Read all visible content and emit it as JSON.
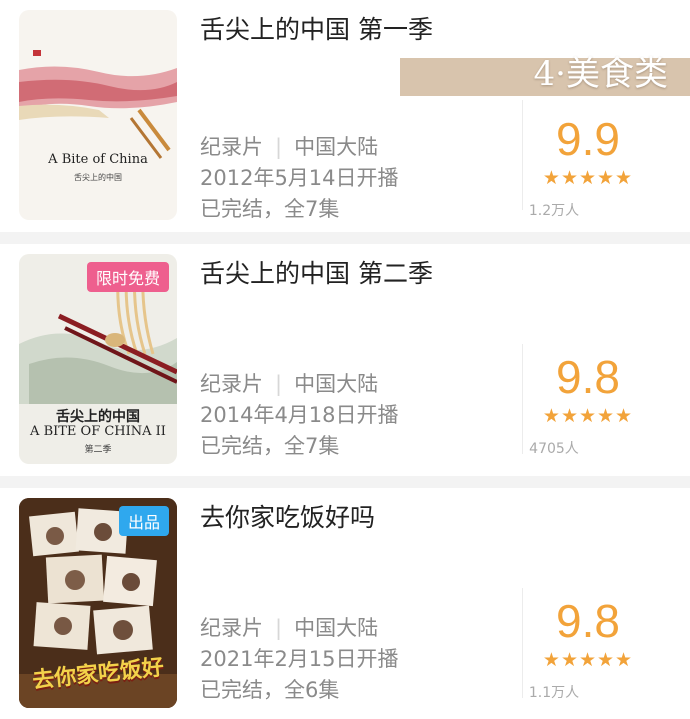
{
  "banner": {
    "text": "4·美食类"
  },
  "stars": "★★★★★",
  "items": [
    {
      "title": "舌尖上的中国 第一季",
      "genre": "纪录片",
      "region": "中国大陆",
      "premiere": "2012年5月14日开播",
      "status": "已完结，全7集",
      "score": "9.9",
      "votes": "1.2万人",
      "poster": {
        "en": "A Bite of China",
        "cn": "舌尖上的中国"
      }
    },
    {
      "title": "舌尖上的中国 第二季",
      "genre": "纪录片",
      "region": "中国大陆",
      "premiere": "2014年4月18日开播",
      "status": "已完结，全7集",
      "score": "9.8",
      "votes": "4705人",
      "badge": "限时免费",
      "poster": {
        "cn": "舌尖上的中国",
        "en": "A BITE OF CHINA II",
        "season": "第二季"
      }
    },
    {
      "title": "去你家吃饭好吗",
      "genre": "纪录片",
      "region": "中国大陆",
      "premiere": "2021年2月15日开播",
      "status": "已完结，全6集",
      "score": "9.8",
      "votes": "1.1万人",
      "badge": "出品",
      "poster": {
        "script": "去你家吃饭好"
      }
    }
  ],
  "colors": {
    "score": "#f2a33a",
    "badge_free": "#ee5f8e",
    "badge_produced": "#2fa8ee",
    "banner": "#d8c4ad"
  }
}
